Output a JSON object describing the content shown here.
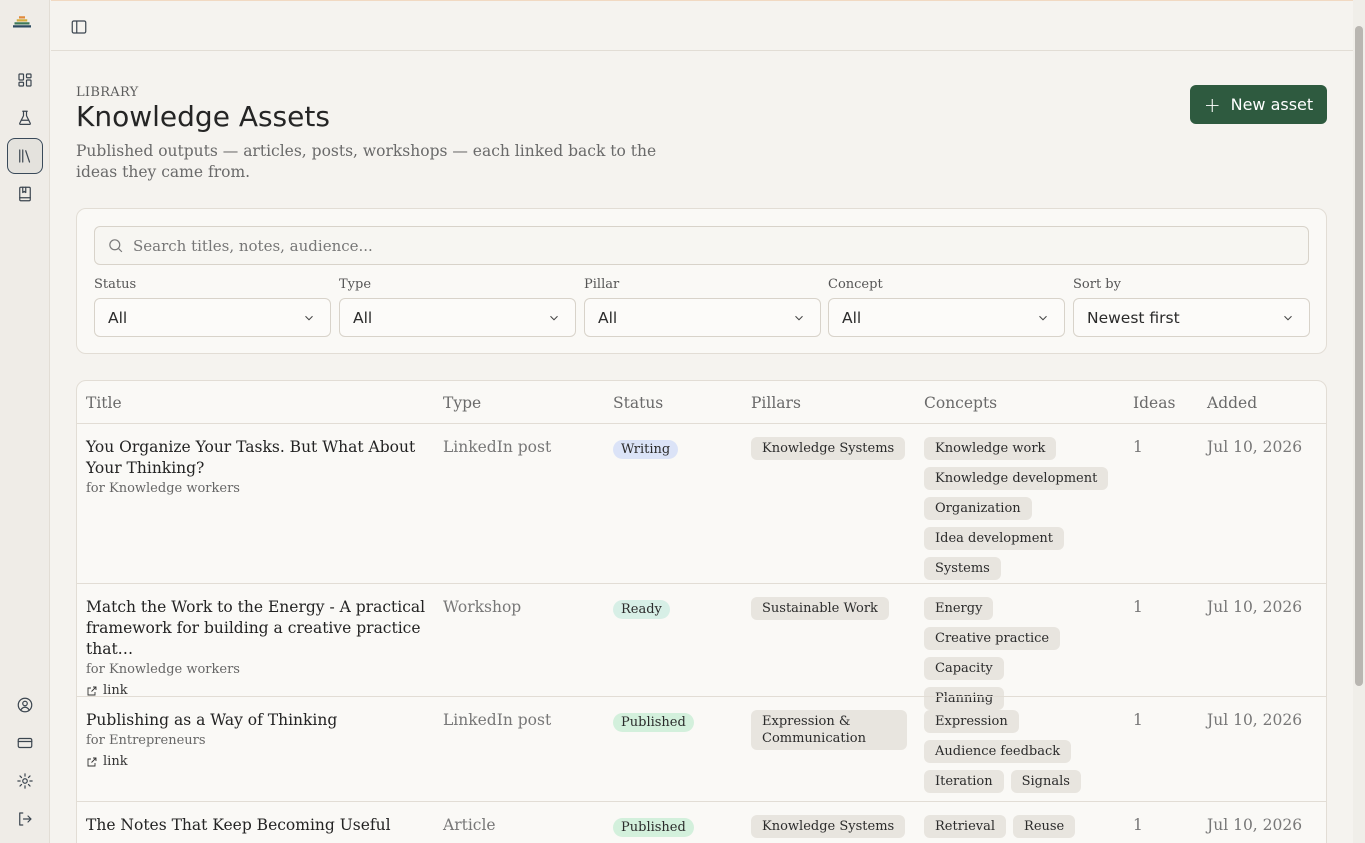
{
  "header": {
    "eyebrow": "LIBRARY",
    "title": "Knowledge Assets",
    "description": "Published outputs — articles, posts, workshops — each linked back to the ideas they came from.",
    "new_button": "New asset"
  },
  "search": {
    "placeholder": "Search titles, notes, audience..."
  },
  "filters": [
    {
      "label": "Status",
      "value": "All"
    },
    {
      "label": "Type",
      "value": "All"
    },
    {
      "label": "Pillar",
      "value": "All"
    },
    {
      "label": "Concept",
      "value": "All"
    },
    {
      "label": "Sort by",
      "value": "Newest first"
    }
  ],
  "table": {
    "headers": [
      "Title",
      "Type",
      "Status",
      "Pillars",
      "Concepts",
      "Ideas",
      "Added"
    ],
    "rows": [
      {
        "title": "You Organize Your Tasks. But What About Your Thinking?",
        "audience": "for Knowledge workers",
        "link": "",
        "type": "LinkedIn post",
        "status": "Writing",
        "pillar": "Knowledge Systems",
        "concepts": [
          "Knowledge work",
          "Knowledge development",
          "Organization",
          "Idea development",
          "Systems"
        ],
        "ideas": "1",
        "added": "Jul 10, 2026"
      },
      {
        "title": "Match the Work to the Energy - A practical framework for building a creative practice that…",
        "audience": "for Knowledge workers",
        "link": "link",
        "type": "Workshop",
        "status": "Ready",
        "pillar": "Sustainable Work",
        "concepts": [
          "Energy",
          "Creative practice",
          "Capacity",
          "Planning"
        ],
        "ideas": "1",
        "added": "Jul 10, 2026"
      },
      {
        "title": "Publishing as a Way of Thinking",
        "audience": "for Entrepreneurs",
        "link": "link",
        "type": "LinkedIn post",
        "status": "Published",
        "pillar": "Expression & Communication",
        "concepts": [
          "Expression",
          "Audience feedback",
          "Iteration",
          "Signals"
        ],
        "ideas": "1",
        "added": "Jul 10, 2026"
      },
      {
        "title": "The Notes That Keep Becoming Useful",
        "audience": "",
        "link": "",
        "type": "Article",
        "status": "Published",
        "pillar": "Knowledge Systems",
        "concepts": [
          "Retrieval",
          "Reuse"
        ],
        "ideas": "1",
        "added": "Jul 10, 2026"
      }
    ]
  },
  "colors": {
    "accent": "#2e5a3f",
    "status_writing": "#dbe3f7",
    "status_ready": "#d7efe6",
    "status_published": "#d3f0dc"
  }
}
